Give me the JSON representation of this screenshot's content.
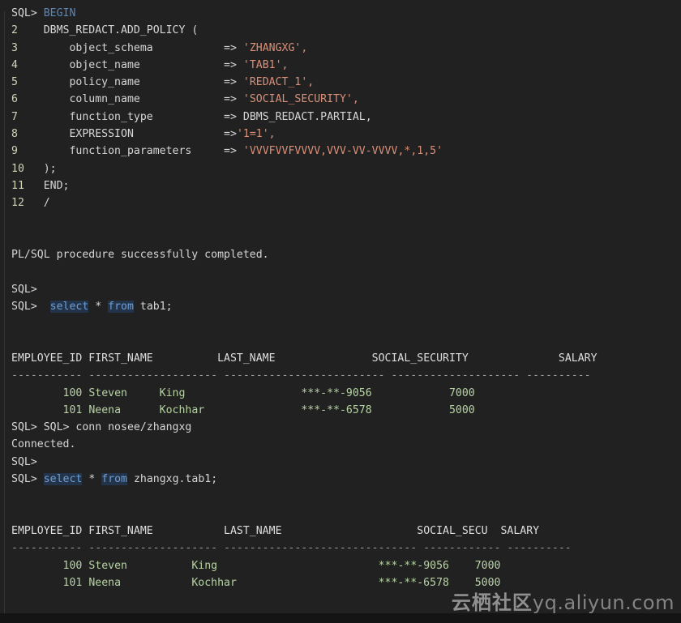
{
  "terminal": {
    "app": "SQL*Plus",
    "background_color": "#212121",
    "foreground_color": "#d6d6d6",
    "accent_keyword_color": "#5a86b8",
    "string_color": "#d98f78",
    "result_value_color": "#b7d3a4"
  },
  "block_begin": {
    "prompt": "SQL>",
    "keyword": "BEGIN"
  },
  "plsql_lines": [
    {
      "num": "2",
      "indent": "    ",
      "text": "DBMS_REDACT.ADD_POLICY ("
    },
    {
      "num": "3",
      "indent": "        ",
      "param": "object_schema",
      "arrow": "=>",
      "value": "'ZHANGXG',",
      "value_type": "string"
    },
    {
      "num": "4",
      "indent": "        ",
      "param": "object_name",
      "arrow": "=>",
      "value": "'TAB1',",
      "value_type": "string"
    },
    {
      "num": "5",
      "indent": "        ",
      "param": "policy_name",
      "arrow": "=>",
      "value": "'REDACT_1',",
      "value_type": "string"
    },
    {
      "num": "6",
      "indent": "        ",
      "param": "column_name",
      "arrow": "=>",
      "value": "'SOCIAL_SECURITY',",
      "value_type": "string"
    },
    {
      "num": "7",
      "indent": "        ",
      "param": "function_type",
      "arrow": "=>",
      "value": "DBMS_REDACT.PARTIAL,",
      "value_type": "plain"
    },
    {
      "num": "8",
      "indent": "        ",
      "param": "EXPRESSION",
      "arrow": "=>",
      "value": "'1=1',",
      "value_type": "string",
      "no_space_after_arrow": true
    },
    {
      "num": "9",
      "indent": "        ",
      "param": "function_parameters",
      "arrow": "=>",
      "value": "'VVVFVVFVVVV,VVV-VV-VVVV,*,1,5'",
      "value_type": "string"
    },
    {
      "num": "10",
      "indent": "    ",
      "text": ");"
    },
    {
      "num": "11",
      "indent": "    ",
      "text": "END;"
    },
    {
      "num": "12",
      "indent": "    ",
      "text": "/"
    }
  ],
  "messages": {
    "plsql_completed": "PL/SQL procedure successfully completed.",
    "connected": "Connected."
  },
  "prompts": {
    "bare": "SQL>",
    "double": "SQL> SQL>"
  },
  "commands": {
    "select_tab1": {
      "keyword1": "select",
      "star": "*",
      "keyword2": "from",
      "object": "tab1;"
    },
    "conn": "conn nosee/zhangxg",
    "select_zhangxg_tab1": {
      "keyword1": "select",
      "star": "*",
      "keyword2": "from",
      "object": "zhangxg.tab1;"
    }
  },
  "result_table_1": {
    "headers": [
      "EMPLOYEE_ID",
      "FIRST_NAME",
      "LAST_NAME",
      "SOCIAL_SECURITY",
      "SALARY"
    ],
    "separator": "----------- -------------------- ------------------------- -------------------- ----------",
    "rows": [
      {
        "employee_id": "100",
        "first_name": "Steven",
        "last_name": "King",
        "social_security": "***-**-9056",
        "salary": "7000"
      },
      {
        "employee_id": "101",
        "first_name": "Neena",
        "last_name": "Kochhar",
        "social_security": "***-**-6578",
        "salary": "5000"
      }
    ]
  },
  "result_table_2": {
    "headers": [
      "EMPLOYEE_ID",
      "FIRST_NAME",
      "LAST_NAME",
      "SOCIAL_SECU",
      "SALARY"
    ],
    "separator": "----------- -------------------- ------------------------------ ------------ ----------",
    "rows": [
      {
        "employee_id": "100",
        "first_name": "Steven",
        "last_name": "King",
        "social_security": "***-**-9056",
        "salary": "7000"
      },
      {
        "employee_id": "101",
        "first_name": "Neena",
        "last_name": "Kochhar",
        "social_security": "***-**-6578",
        "salary": "5000"
      }
    ]
  },
  "watermark": {
    "cn": "云栖社区",
    "url": "yq.aliyun.com"
  }
}
